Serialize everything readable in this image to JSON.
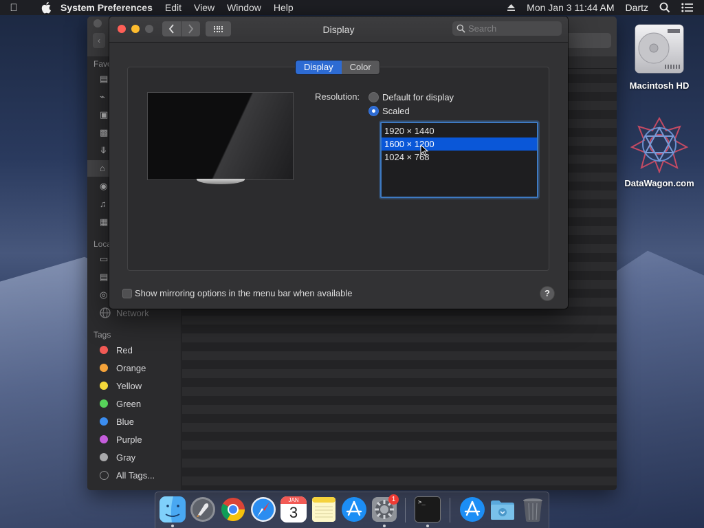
{
  "menubar": {
    "app_name": "System Preferences",
    "menus": [
      "Edit",
      "View",
      "Window",
      "Help"
    ],
    "clock": "Mon Jan 3  11:44 AM",
    "user": "Dartz"
  },
  "finder": {
    "sections": {
      "favorites": "Favo",
      "locations": "Loca",
      "tags": "Tags"
    },
    "network_label": "Network",
    "tags": [
      {
        "label": "Red",
        "color": "#f25a55"
      },
      {
        "label": "Orange",
        "color": "#f5a33a"
      },
      {
        "label": "Yellow",
        "color": "#f4d83a"
      },
      {
        "label": "Green",
        "color": "#57d35a"
      },
      {
        "label": "Blue",
        "color": "#3b8df0"
      },
      {
        "label": "Purple",
        "color": "#c55ddc"
      },
      {
        "label": "Gray",
        "color": "#a8a8aa"
      }
    ],
    "all_tags_label": "All Tags..."
  },
  "prefs": {
    "title": "Display",
    "search_placeholder": "Search",
    "tabs": [
      {
        "label": "Display",
        "active": true
      },
      {
        "label": "Color",
        "active": false
      }
    ],
    "resolution_label": "Resolution:",
    "radio_default": "Default for display",
    "radio_scaled": "Scaled",
    "resolutions": [
      {
        "label": "1920 × 1440",
        "selected": false
      },
      {
        "label": "1600 × 1200",
        "selected": true
      },
      {
        "label": "1024 × 768",
        "selected": false
      }
    ],
    "mirroring_label": "Show mirroring options in the menu bar when available",
    "help_label": "?"
  },
  "desktop": {
    "icons": [
      {
        "label": "Macintosh HD"
      },
      {
        "label": "DataWagon.com"
      }
    ]
  },
  "dock": {
    "calendar_month": "JAN",
    "calendar_day": "3",
    "sysprefs_badge": "1",
    "terminal_prompt": ">_"
  },
  "colors": {
    "accent": "#2d6bd3",
    "selection": "#0a57d8"
  }
}
